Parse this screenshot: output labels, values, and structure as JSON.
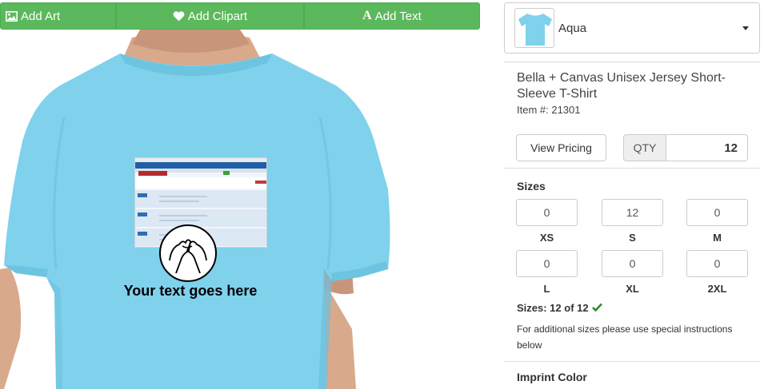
{
  "toolbar": {
    "add_art": "Add Art",
    "add_clipart": "Add Clipart",
    "add_text": "Add Text",
    "add_text_icon_glyph": "A"
  },
  "canvas": {
    "shirt_color": "#7fd1ec",
    "text_layer": "Your text goes here"
  },
  "product": {
    "color_name": "Aqua",
    "name": "Bella + Canvas Unisex Jersey Short-Sleeve T-Shirt",
    "item_number": "Item #: 21301",
    "view_pricing": "View Pricing",
    "qty_label": "QTY",
    "qty_value": "12"
  },
  "sizes": {
    "title": "Sizes",
    "items": [
      {
        "label": "XS",
        "value": "0"
      },
      {
        "label": "S",
        "value": "12"
      },
      {
        "label": "M",
        "value": "0"
      },
      {
        "label": "L",
        "value": "0"
      },
      {
        "label": "XL",
        "value": "0"
      },
      {
        "label": "2XL",
        "value": "0"
      }
    ],
    "summary": "Sizes: 12 of 12",
    "note": "For additional sizes please use special instructions below"
  },
  "imprint": {
    "title": "Imprint Color"
  },
  "colors": {
    "button_green": "#5cb85c",
    "check_green": "#2e8b2e"
  }
}
